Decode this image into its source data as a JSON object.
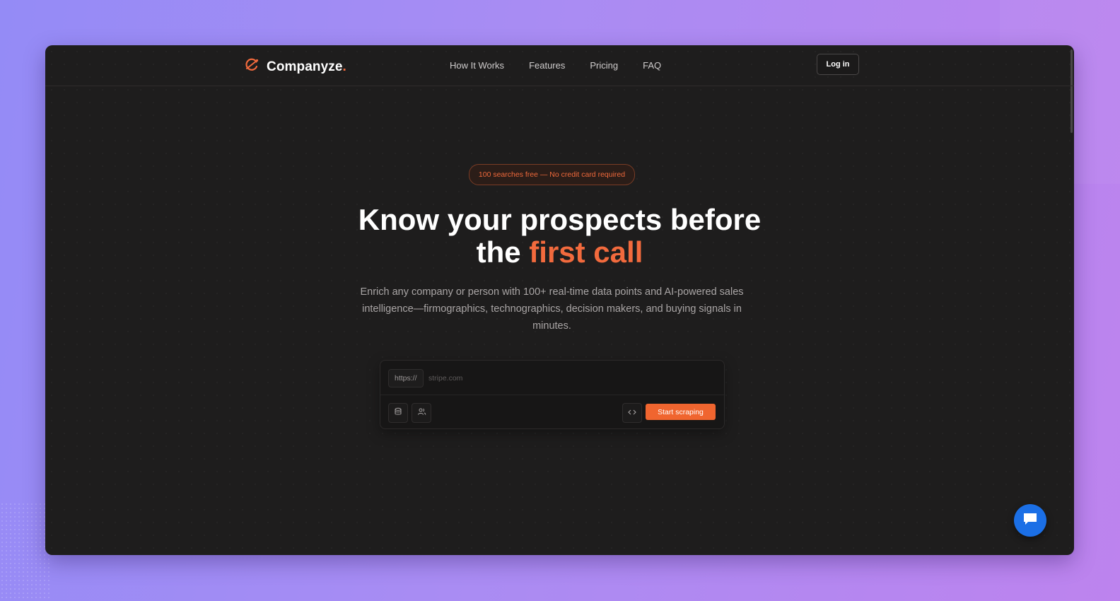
{
  "brand": {
    "name": "Companyze",
    "dot": ".",
    "accent_color": "#f26a3d",
    "logo_icon": "orbit-icon"
  },
  "nav": {
    "links": [
      "How It Works",
      "Features",
      "Pricing",
      "FAQ"
    ],
    "login_label": "Log in"
  },
  "hero": {
    "badge": "100 searches free — No credit card required",
    "headline_line1": "Know your prospects before",
    "headline_line2_plain": "the",
    "headline_line2_accent": "first call",
    "subtitle": "Enrich any company or person with 100+ real-time data points and AI-powered sales intelligence—firmographics, technographics, decision makers, and buying signals in minutes."
  },
  "search": {
    "prefix": "https://",
    "placeholder": "stripe.com",
    "value": "",
    "tools": [
      "database-icon",
      "users-icon",
      "code-icon"
    ],
    "start_label": "Start scraping",
    "button_color": "#f0652f"
  },
  "chat": {
    "icon": "chat-bubble-icon",
    "color": "#1b6fe6"
  }
}
